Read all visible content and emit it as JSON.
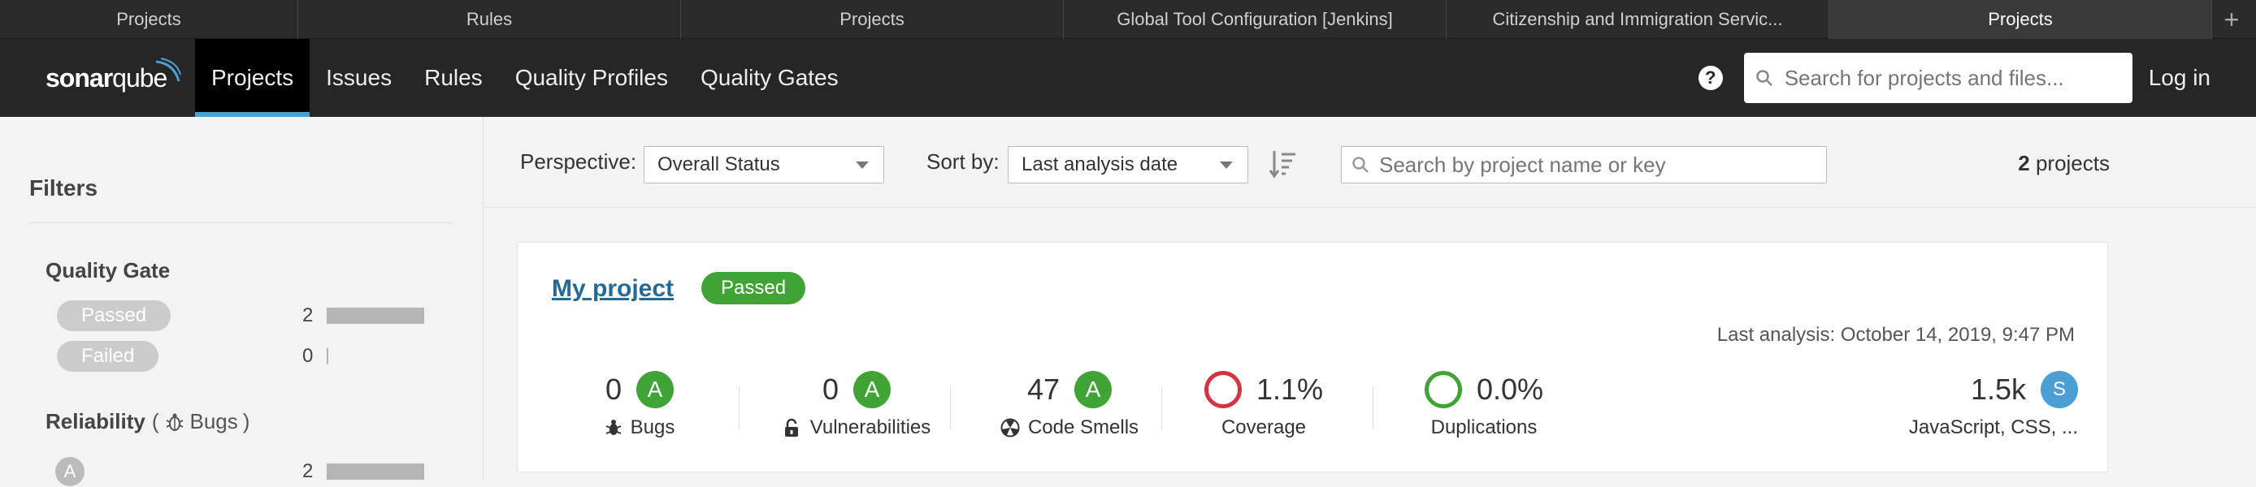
{
  "browser_tabs": [
    {
      "label": "Projects"
    },
    {
      "label": "Rules"
    },
    {
      "label": "Projects"
    },
    {
      "label": "Global Tool Configuration [Jenkins]"
    },
    {
      "label": "Citizenship and Immigration Servic..."
    },
    {
      "label": "Projects"
    }
  ],
  "new_tab_symbol": "+",
  "nav": {
    "logo_part1": "sonar",
    "logo_part2": "qube",
    "items": [
      "Projects",
      "Issues",
      "Rules",
      "Quality Profiles",
      "Quality Gates"
    ],
    "help_symbol": "?",
    "search_placeholder": "Search for projects and files...",
    "login_label": "Log in"
  },
  "sidebar": {
    "title": "Filters",
    "quality_gate": {
      "title": "Quality Gate",
      "options": [
        {
          "label": "Passed",
          "count": "2",
          "share": 1.0
        },
        {
          "label": "Failed",
          "count": "0",
          "share": 0.0
        }
      ]
    },
    "reliability": {
      "title": "Reliability",
      "paren_open": "(",
      "sub_label": "Bugs",
      "paren_close": ")",
      "options": [
        {
          "label": "A",
          "count": "2",
          "share": 1.0
        }
      ]
    }
  },
  "toolbar": {
    "perspective_label": "Perspective:",
    "perspective_value": "Overall Status",
    "sort_label": "Sort by:",
    "sort_value": "Last analysis date",
    "search_placeholder": "Search by project name or key",
    "count_number": "2",
    "count_suffix": "projects"
  },
  "project": {
    "name": "My project",
    "status": "Passed",
    "last_analysis": "Last analysis: October 14, 2019, 9:47 PM",
    "metrics": {
      "bugs": {
        "value": "0",
        "grade": "A",
        "label": "Bugs"
      },
      "vulnerabilities": {
        "value": "0",
        "grade": "A",
        "label": "Vulnerabilities"
      },
      "code_smells": {
        "value": "47",
        "grade": "A",
        "label": "Code Smells"
      },
      "coverage": {
        "value": "1.1%",
        "label": "Coverage"
      },
      "duplications": {
        "value": "0.0%",
        "label": "Duplications"
      },
      "size": {
        "value": "1.5k",
        "badge": "S",
        "label": "JavaScript, CSS, ..."
      }
    }
  },
  "colors": {
    "pass_green": "#3fa336",
    "fail_red": "#d4333f",
    "accent_blue": "#4b9fd5",
    "link_blue": "#236a97"
  }
}
